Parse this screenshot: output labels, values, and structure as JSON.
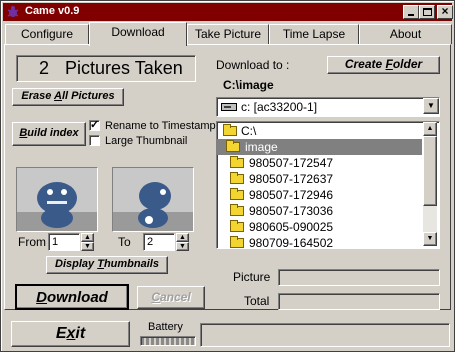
{
  "window": {
    "title": "Came v0.9"
  },
  "tabs": [
    {
      "label": "Configure"
    },
    {
      "label": "Download"
    },
    {
      "label": "Take Picture"
    },
    {
      "label": "Time Lapse"
    },
    {
      "label": "About"
    }
  ],
  "status": {
    "pictures_count": "2",
    "pictures_label": "Pictures Taken"
  },
  "buttons": {
    "erase_prefix": "Erase ",
    "erase_ul": "A",
    "erase_suffix": "ll Pictures",
    "build_ul": "B",
    "build_suffix": "uild index",
    "display_prefix": "Display ",
    "display_ul": "T",
    "display_suffix": "humbnails",
    "download_ul": "D",
    "download_suffix": "ownload",
    "cancel_ul": "C",
    "cancel_suffix": "ancel",
    "exit_prefix": "E",
    "exit_ul": "x",
    "exit_suffix": "it",
    "create_prefix": "Create ",
    "create_ul": "F",
    "create_suffix": "older"
  },
  "options": {
    "rename_label": "Rename to Timestamp",
    "rename_checked": true,
    "large_label": "Large Thumbnail",
    "large_checked": false
  },
  "range": {
    "from_label": "From",
    "from_value": "1",
    "to_label": "To",
    "to_value": "2"
  },
  "download_to": {
    "label": "Download to :",
    "path": "C:\\image",
    "drive": "c: [ac33200-1]",
    "tree": [
      {
        "name": "C:\\",
        "open": true,
        "selected": false
      },
      {
        "name": "image",
        "open": true,
        "selected": true
      },
      {
        "name": "980507-172547",
        "open": false,
        "selected": false
      },
      {
        "name": "980507-172637",
        "open": false,
        "selected": false
      },
      {
        "name": "980507-172946",
        "open": false,
        "selected": false
      },
      {
        "name": "980507-173036",
        "open": false,
        "selected": false
      },
      {
        "name": "980605-090025",
        "open": false,
        "selected": false
      },
      {
        "name": "980709-164502",
        "open": false,
        "selected": false
      }
    ]
  },
  "progress": {
    "picture_label": "Picture",
    "total_label": "Total"
  },
  "battery": {
    "label": "Battery"
  }
}
